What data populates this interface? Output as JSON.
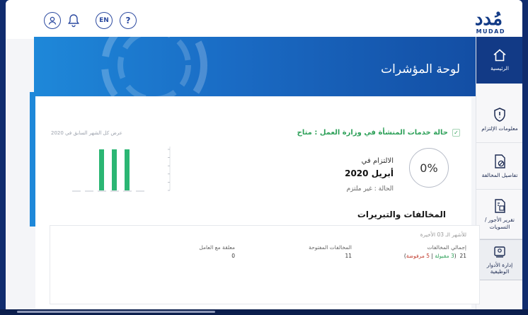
{
  "header": {
    "language_label": "EN",
    "help_label": "?",
    "logo_word": "مُدد",
    "logo_sub": "MUDAD"
  },
  "banner": {
    "title": "لوحة المؤشرات"
  },
  "nav": [
    {
      "label": "الرئيسية",
      "icon": "home-icon",
      "active": true
    },
    {
      "label": "معلومات الإلتزام",
      "icon": "shield-icon",
      "active": false
    },
    {
      "label": "تفاصيل المخالفة",
      "icon": "violation-icon",
      "active": false
    },
    {
      "label": "تقرير الأجور / التسويات",
      "icon": "report-icon",
      "active": false
    },
    {
      "label": "إدارة الأدوار الوظيفية",
      "icon": "roles-icon",
      "active": false
    }
  ],
  "status": {
    "text": "حالة خدمات المنشأة في وزارة العمل : متاح"
  },
  "compliance": {
    "percent": "0%",
    "label": "الالتزام في",
    "month": "أبريل 2020",
    "status": "الحالة : غير ملتزم"
  },
  "chart_caption": "عرض كل الشهر السابق في 2020",
  "chart_data": {
    "type": "bar",
    "categories": [
      "1",
      "2",
      "3",
      "4",
      "5",
      "6"
    ],
    "values": [
      0,
      0,
      1,
      1,
      1,
      0
    ],
    "ylim": [
      0,
      1
    ],
    "bar_color": "#2bb673"
  },
  "violations": {
    "title": "المخالفات والتبريرات",
    "period": "للأشهر الـ 03 الأخيرة",
    "total_label": "إجمالي المخالفات",
    "total_value": "21",
    "accepted": "3 مقبولة",
    "rejected": "5 مرفوضة",
    "open_label": "المخالفات المفتوحة",
    "open_value": "11",
    "pending_label": "معلقة مع العامل",
    "pending_value": "0"
  },
  "colors": {
    "primary": "#123a86",
    "banner": "#1a6bc4",
    "success": "#2fa15a"
  }
}
